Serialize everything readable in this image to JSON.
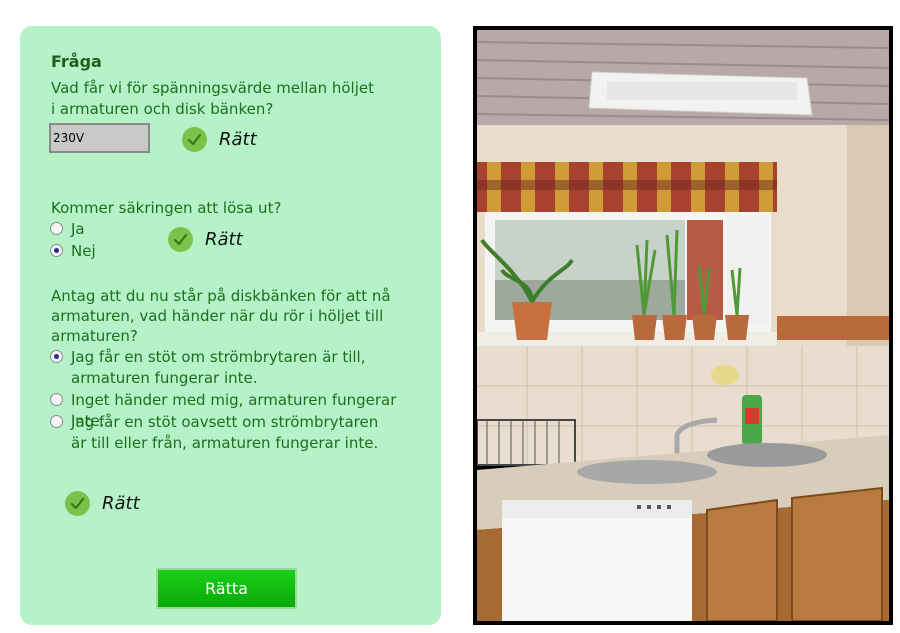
{
  "quiz": {
    "heading": "Fråga",
    "q1": {
      "text": "Vad får vi för spänningsvärde mellan höljet i armaturen och disk bänken?",
      "answer_value": "230V",
      "feedback": "Rätt"
    },
    "q2": {
      "text": "Kommer säkringen att lösa ut?",
      "options": [
        {
          "label": "Ja",
          "selected": false
        },
        {
          "label": "Nej",
          "selected": true
        }
      ],
      "feedback": "Rätt"
    },
    "q3": {
      "text": "Antag att du nu står på diskbänken för att nå armaturen, vad händer när du rör i höljet till armaturen?",
      "options": [
        {
          "label": "Jag får en stöt om strömbrytaren är till, armaturen fungerar inte.",
          "selected": true
        },
        {
          "label": "Inget händer med mig, armaturen fungerar inte.",
          "selected": false
        },
        {
          "label": "Jag får en stöt oavsett om strömbrytaren är till eller från, armaturen fungerar inte.",
          "selected": false
        }
      ],
      "feedback": "Rätt"
    },
    "submit_label": "Rätta"
  },
  "colors": {
    "panel_bg": "#b5f2c8",
    "text": "#1e6e1e",
    "check": "#79c34b",
    "button": "#0fbf0f"
  },
  "icons": {
    "correct": "check-circle-icon"
  }
}
